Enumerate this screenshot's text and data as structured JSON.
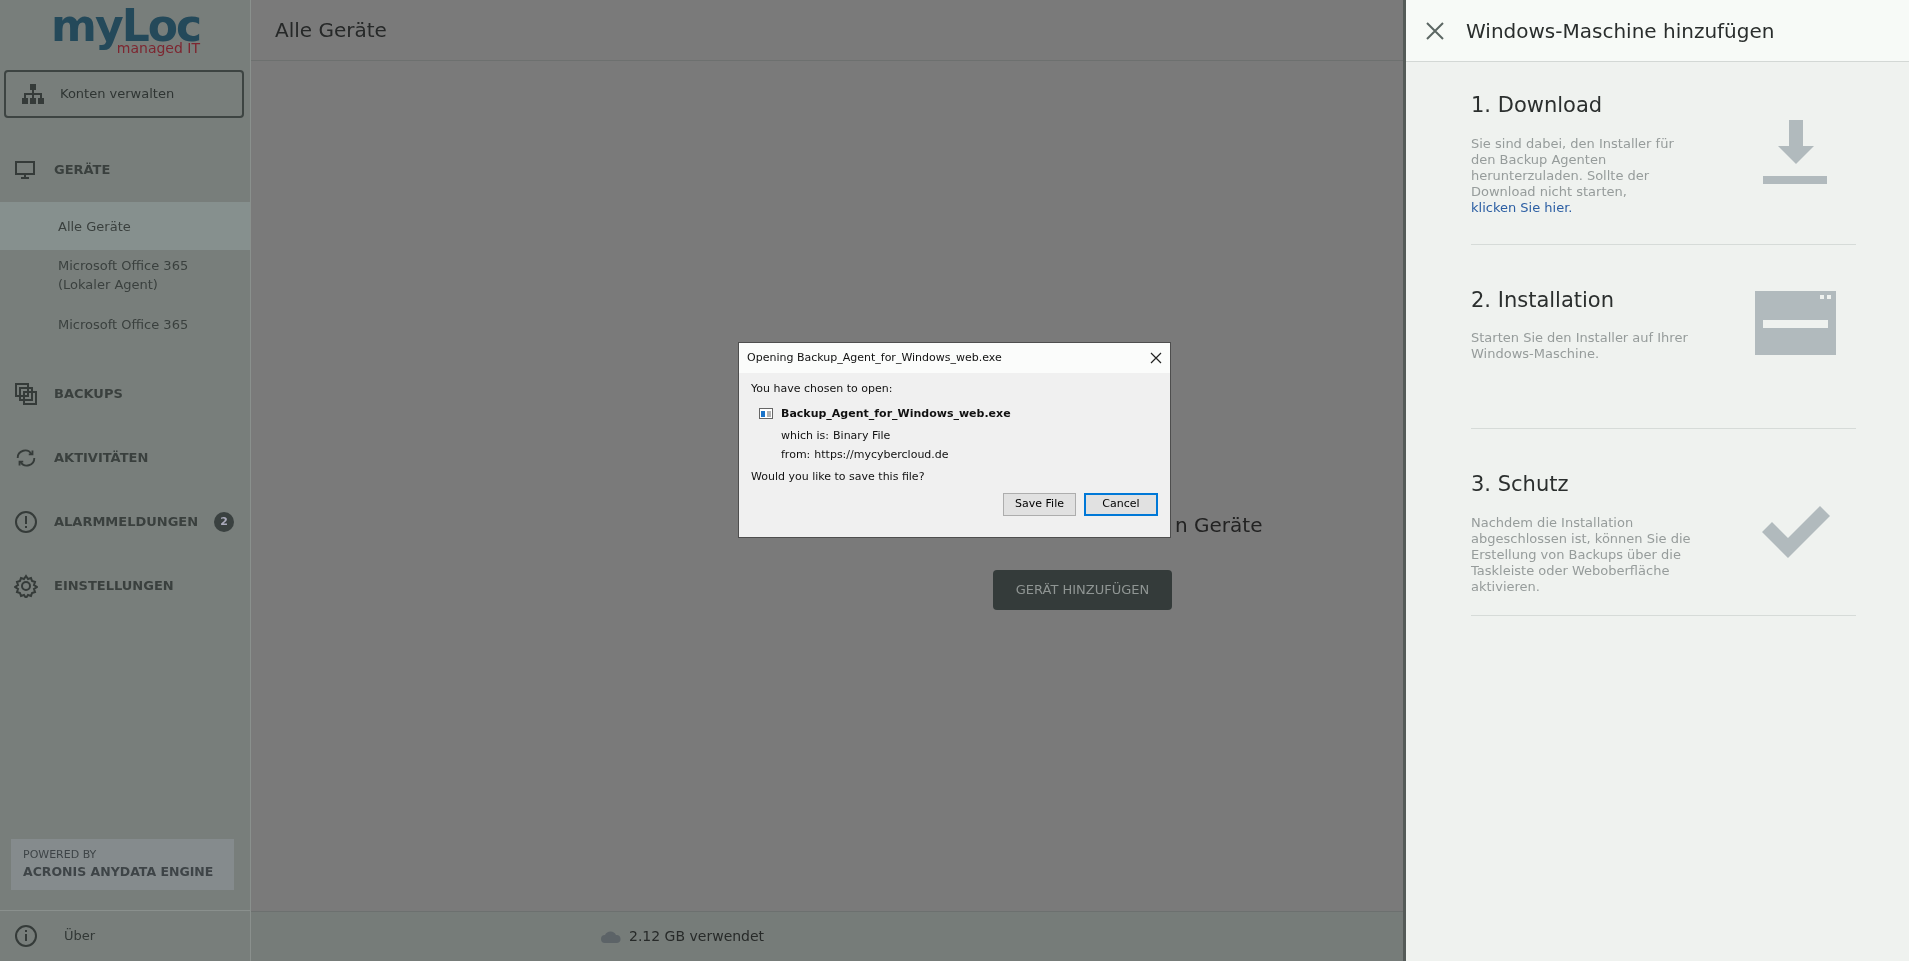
{
  "logo": {
    "brand": "myLoc",
    "tagline": "managed IT"
  },
  "sidebar": {
    "account_button": "Konten verwalten",
    "sections": [
      {
        "label": "GERÄTE",
        "children": [
          {
            "label": "Alle Geräte",
            "selected": true
          },
          {
            "label": "Microsoft Office 365 (Lokaler Agent)",
            "selected": false
          },
          {
            "label": "Microsoft Office 365",
            "selected": false
          }
        ]
      },
      {
        "label": "BACKUPS"
      },
      {
        "label": "AKTIVITÄTEN"
      },
      {
        "label": "ALARMMELDUNGEN",
        "badge": "2"
      },
      {
        "label": "EINSTELLUNGEN"
      }
    ],
    "powered_by": {
      "caption": "POWERED BY",
      "engine": "ACRONIS ANYDATA ENGINE"
    },
    "about": "Über"
  },
  "main": {
    "title": "Alle Geräte",
    "empty_text": "n Geräte",
    "add_button": "GERÄT HINZUFÜGEN",
    "usage": "2.12 GB verwendet"
  },
  "dialog": {
    "title": "Opening Backup_Agent_for_Windows_web.exe",
    "intro": "You have chosen to open:",
    "file_name": "Backup_Agent_for_Windows_web.exe",
    "fields": [
      {
        "label": "which is:",
        "value": "Binary File"
      },
      {
        "label": "from:",
        "value": "https://mycybercloud.de"
      }
    ],
    "question": "Would you like to save this file?",
    "buttons": [
      {
        "label": "Save File",
        "default": false
      },
      {
        "label": "Cancel",
        "default": true
      }
    ]
  },
  "panel": {
    "title": "Windows-Maschine hinzufügen",
    "steps": [
      {
        "title": "1. Download",
        "text": "Sie sind dabei, den Installer für den Backup Agenten herunterzuladen. Sollte der Download nicht starten,",
        "link": "klicken Sie hier."
      },
      {
        "title": "2. Installation",
        "text": "Starten Sie den Installer auf Ihrer Windows-Maschine."
      },
      {
        "title": "3. Schutz",
        "text": "Nachdem die Installation abgeschlossen ist, können Sie die Erstellung von Backups über die Taskleiste oder Weboberfläche aktivieren."
      }
    ]
  }
}
